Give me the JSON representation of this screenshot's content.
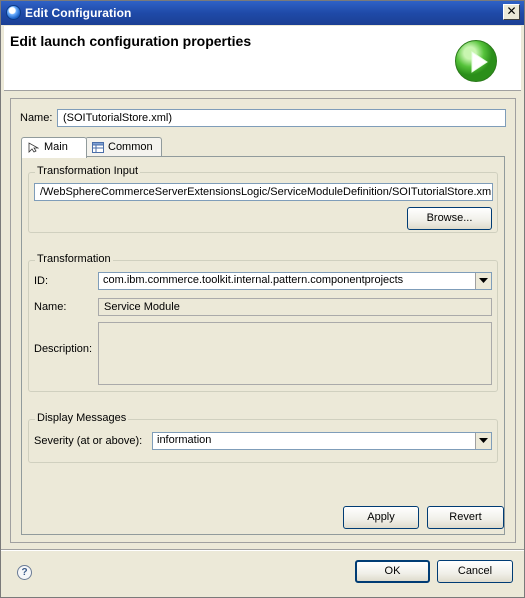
{
  "window": {
    "title": "Edit Configuration",
    "close_glyph": "✕"
  },
  "banner": {
    "heading": "Edit launch configuration properties",
    "icon": "run-play-icon"
  },
  "name_row": {
    "label": "Name:",
    "value": "(SOITutorialStore.xml)"
  },
  "tabs": [
    {
      "label": "Main",
      "icon": "main-tab-icon",
      "active": true
    },
    {
      "label": "Common",
      "icon": "common-tab-icon",
      "active": false
    }
  ],
  "transformation_input": {
    "title": "Transformation Input",
    "path": "/WebSphereCommerceServerExtensionsLogic/ServiceModuleDefinition/SOITutorialStore.xml",
    "browse_label": "Browse..."
  },
  "transformation": {
    "title": "Transformation",
    "id_label": "ID:",
    "id_value": "com.ibm.commerce.toolkit.internal.pattern.componentprojects",
    "name_label": "Name:",
    "name_value": "Service Module",
    "description_label": "Description:",
    "description_value": ""
  },
  "display_messages": {
    "title": "Display Messages",
    "severity_label": "Severity (at or above):",
    "severity_value": "information"
  },
  "panel_buttons": {
    "apply": "Apply",
    "revert": "Revert"
  },
  "dialog_buttons": {
    "ok": "OK",
    "cancel": "Cancel",
    "help_glyph": "?"
  }
}
